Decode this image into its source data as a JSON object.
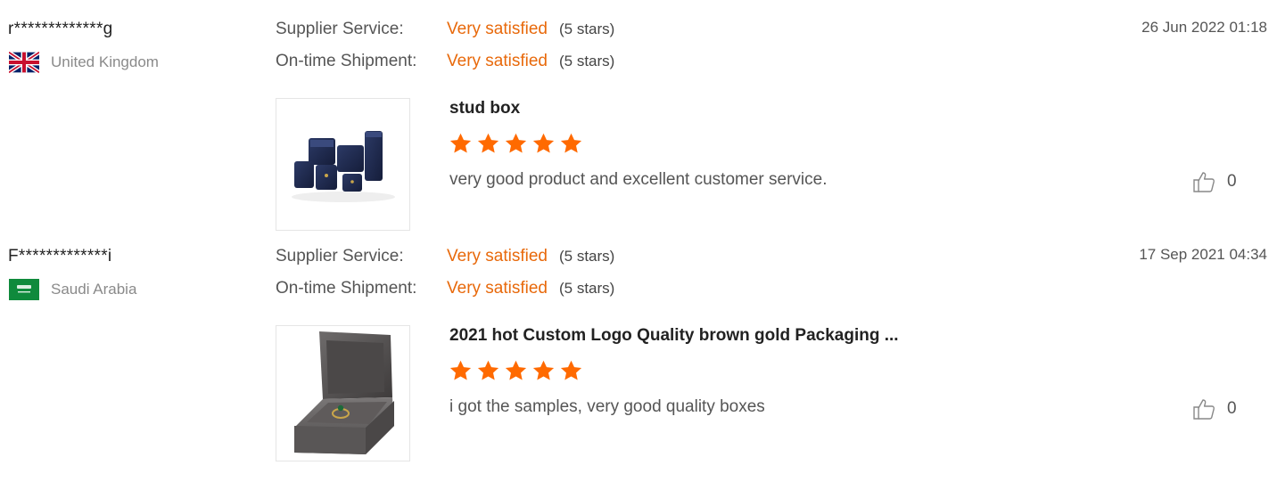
{
  "reviews": [
    {
      "buyer": "r*************g",
      "country": "United Kingdom",
      "country_flag_icon": "uk-flag-icon",
      "supplier_service_label": "Supplier Service:",
      "supplier_service_value": "Very satisfied",
      "supplier_service_stars": "(5 stars)",
      "shipment_label": "On-time Shipment:",
      "shipment_value": "Very satisfied",
      "shipment_stars": "(5 stars)",
      "date": "26 Jun 2022 01:18",
      "product_title": "stud box",
      "product_image_icon": "jewelry-box-set-image",
      "rating": 5,
      "comment": "very good product and excellent customer service.",
      "likes": "0"
    },
    {
      "buyer": "F*************i",
      "country": "Saudi Arabia",
      "country_flag_icon": "saudi-flag-icon",
      "supplier_service_label": "Supplier Service:",
      "supplier_service_value": "Very satisfied",
      "supplier_service_stars": "(5 stars)",
      "shipment_label": "On-time Shipment:",
      "shipment_value": "Very satisfied",
      "shipment_stars": "(5 stars)",
      "date": "17 Sep 2021 04:34",
      "product_title": "2021 hot Custom Logo Quality brown gold Packaging ...",
      "product_image_icon": "ring-box-image",
      "rating": 5,
      "comment": "i got the samples, very good quality boxes",
      "likes": "0"
    }
  ],
  "colors": {
    "accent": "#e8690b",
    "star": "#ff6a00",
    "muted": "#8a8a8a"
  }
}
